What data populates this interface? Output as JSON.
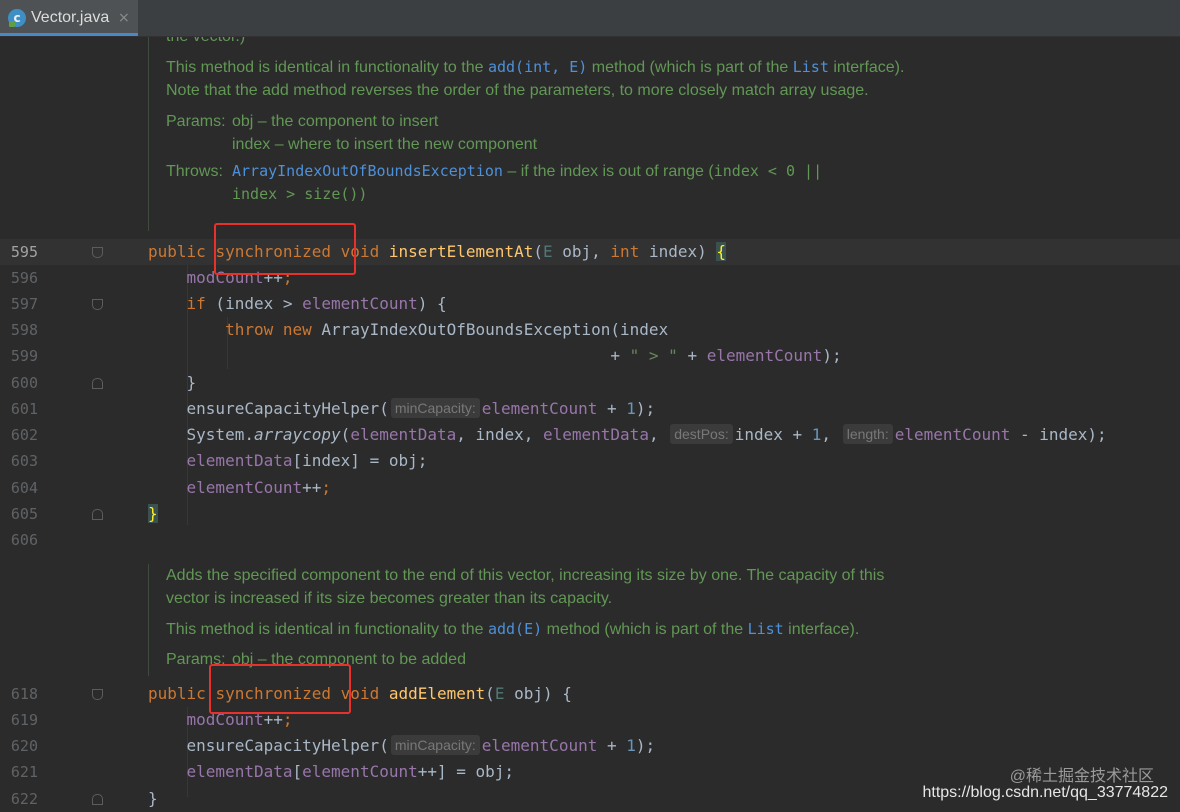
{
  "tab": {
    "icon": "java-class-icon",
    "label": "Vector.java",
    "close": "×"
  },
  "doc1": {
    "top_fragment": "the vector.)",
    "p1_before": "This method is identical in functionality to the ",
    "p1_ref": "add(int, E)",
    "p1_mid": " method (which is part of the ",
    "p1_ref2": "List",
    "p1_after": "interface). Note that the add method reverses the order of the parameters, to more closely match array usage.",
    "params_label": "Params:",
    "param1": "obj – the component to insert",
    "param2": "index – where to insert the new component",
    "throws_label": "Throws:",
    "throws_ref": "ArrayIndexOutOfBoundsException",
    "throws_text": " – if the index is out of range (",
    "throws_code": "index < 0 ||",
    "throws_code2": "index > size())"
  },
  "doc2": {
    "p1": "Adds the specified component to the end of this vector, increasing its size by one. The capacity of this vector is increased if its size becomes greater than its capacity.",
    "p2_before": "This method is identical in functionality to the ",
    "p2_ref": "add(E)",
    "p2_mid": " method (which is part of the ",
    "p2_ref2": "List",
    "p2_after": " interface).",
    "params_label": "Params:",
    "param1": "obj – the component to be added"
  },
  "line_numbers": [
    "595",
    "596",
    "597",
    "598",
    "599",
    "600",
    "601",
    "602",
    "603",
    "604",
    "605",
    "606",
    "618",
    "619",
    "620",
    "621",
    "622"
  ],
  "code": {
    "l595": {
      "public": "public",
      "sync": "synchronized",
      "void": "void",
      "name": "insertElementAt",
      "p1": "(",
      "E": "E",
      "obj": " obj, ",
      "int": "int",
      "rest": " index) ",
      "brace": "{"
    },
    "l596": {
      "fld": "modCount",
      "op": "++",
      "semi": ";"
    },
    "l597": {
      "if": "if",
      "rest": " (index > ",
      "fld": "elementCount",
      "end": ") {"
    },
    "l598": {
      "throw": "throw",
      "new": "new",
      "rest": " ArrayIndexOutOfBoundsException(index"
    },
    "l599": {
      "plus": "+ ",
      "str": "\" > \"",
      "plus2": " + ",
      "fld": "elementCount",
      "end": ");"
    },
    "l600": {
      "brace": "}"
    },
    "l601": {
      "fn": "ensureCapacityHelper(",
      "hint": "minCapacity:",
      "fld": "elementCount",
      "rest": " + ",
      "num": "1",
      "end": ");"
    },
    "l602": {
      "sys": "System.",
      "call": "arraycopy",
      "open": "(",
      "f1": "elementData",
      "a1": ", index, ",
      "f2": "elementData",
      "a2": ",",
      "hint1": "destPos:",
      "a3": "index + ",
      "num": "1",
      "a4": ",",
      "hint2": "length:",
      "f3": "elementCount",
      "a5": " - index);"
    },
    "l603": {
      "fld": "elementData",
      "rest": "[index] = obj;"
    },
    "l604": {
      "fld": "elementCount",
      "op": "++",
      "semi": ";"
    },
    "l605": {
      "brace": "}"
    },
    "l618": {
      "public": "public",
      "sync": "synchronized",
      "void": "void",
      "name": "addElement",
      "p1": "(",
      "E": "E",
      "rest": " obj) {"
    },
    "l619": {
      "fld": "modCount",
      "op": "++",
      "semi": ";"
    },
    "l620": {
      "fn": "ensureCapacityHelper(",
      "hint": "minCapacity:",
      "fld": "elementCount",
      "rest": " + ",
      "num": "1",
      "end": ");"
    },
    "l621": {
      "fld": "elementData",
      "open": "[",
      "fld2": "elementCount",
      "op": "++",
      "rest": "] = obj;"
    },
    "l622": {
      "brace": "}"
    }
  },
  "watermark": {
    "line1": "@稀土掘金技术社区",
    "line2": "https://blog.csdn.net/qq_33774822"
  },
  "colors": {
    "background": "#2b2b2b",
    "keyword": "#cc7832",
    "method": "#ffc66d",
    "field": "#9876aa",
    "doc": "#629755",
    "highlight_box": "#e8312b"
  }
}
